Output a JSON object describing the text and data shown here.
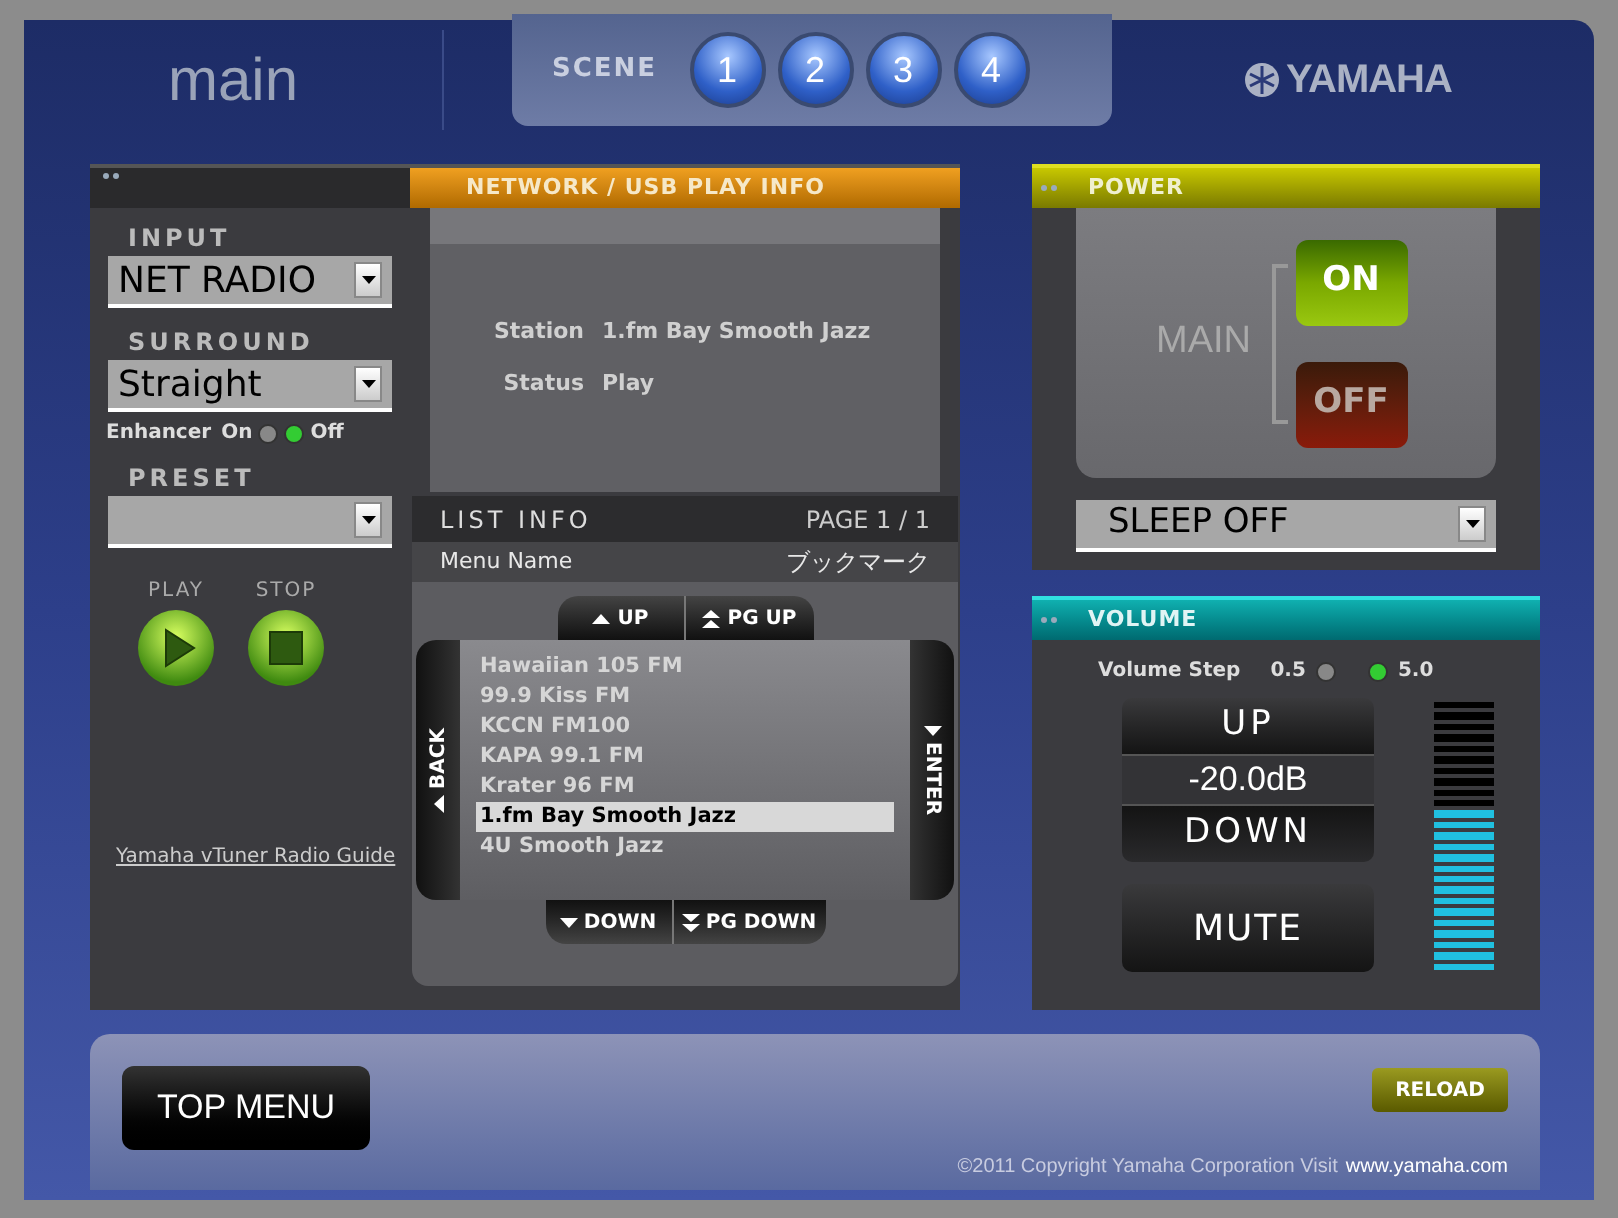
{
  "header": {
    "title": "main",
    "scene_label": "SCENE",
    "scenes": [
      "1",
      "2",
      "3",
      "4"
    ],
    "brand": "YAMAHA"
  },
  "input": {
    "label": "INPUT",
    "value": "NET RADIO"
  },
  "surround": {
    "label": "SURROUND",
    "value": "Straight"
  },
  "enhancer": {
    "label": "Enhancer",
    "options": [
      {
        "label": "On",
        "selected": false
      },
      {
        "label": "Off",
        "selected": true
      }
    ]
  },
  "preset": {
    "label": "PRESET"
  },
  "transport": [
    {
      "label": "PLAY",
      "kind": "play"
    },
    {
      "label": "STOP",
      "kind": "stop"
    }
  ],
  "guide_link": "Yamaha vTuner Radio Guide",
  "play_info": {
    "title": "NETWORK / USB PLAY INFO",
    "fields": [
      {
        "label": "Station",
        "value": "1.fm Bay Smooth Jazz"
      },
      {
        "label": "Status",
        "value": "Play"
      }
    ]
  },
  "list_info": {
    "title": "LIST INFO",
    "page": "PAGE 1 / 1",
    "menu_label": "Menu Name",
    "menu_value": "ブックマーク",
    "top_buttons": [
      {
        "label": "UP",
        "kind": "up"
      },
      {
        "label": "PG UP",
        "kind": "pgup"
      }
    ],
    "back": "BACK",
    "enter": "ENTER",
    "items": [
      {
        "label": "Hawaiian 105 FM",
        "selected": false
      },
      {
        "label": "99.9 Kiss FM",
        "selected": false
      },
      {
        "label": "KCCN FM100",
        "selected": false
      },
      {
        "label": "KAPA 99.1 FM",
        "selected": false
      },
      {
        "label": "Krater 96 FM",
        "selected": false
      },
      {
        "label": "1.fm Bay Smooth Jazz",
        "selected": true
      },
      {
        "label": "4U Smooth Jazz",
        "selected": false
      }
    ],
    "bottom_buttons": [
      {
        "label": "DOWN",
        "kind": "down"
      },
      {
        "label": "PG DOWN",
        "kind": "pgdown"
      }
    ]
  },
  "power": {
    "title": "POWER",
    "zone": "MAIN",
    "buttons": [
      {
        "label": "ON",
        "kind": "on",
        "selected": true
      },
      {
        "label": "OFF",
        "kind": "off",
        "selected": false
      }
    ],
    "sleep": "SLEEP OFF"
  },
  "volume": {
    "title": "VOLUME",
    "step_label": "Volume Step",
    "steps": [
      {
        "label": "0.5",
        "selected": false
      },
      {
        "label": "5.0",
        "selected": true
      }
    ],
    "up": "UP",
    "reading": "-20.0dB",
    "down": "DOWN",
    "mute": "MUTE",
    "level": 0.6
  },
  "footer": {
    "top_menu": "TOP MENU",
    "reload": "RELOAD",
    "copyright": "©2011 Copyright Yamaha Corporation Visit",
    "site": "www.yamaha.com"
  }
}
